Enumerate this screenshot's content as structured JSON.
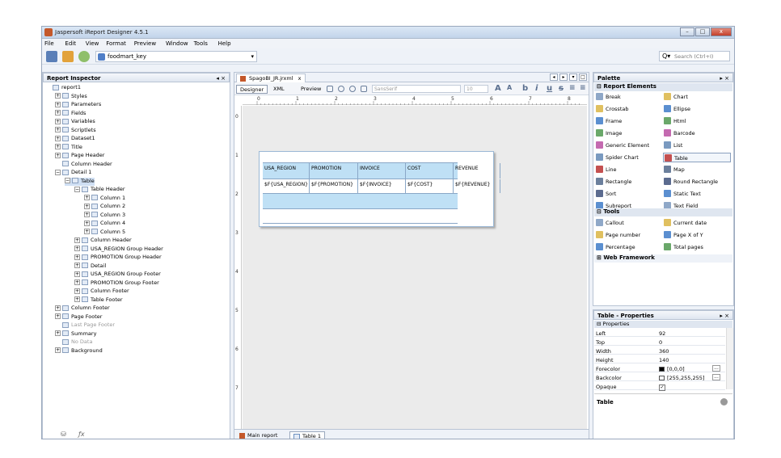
{
  "window": {
    "title": "Jaspersoft iReport Designer 4.5.1",
    "minimize": "–",
    "maximize": "□",
    "close": "x"
  },
  "menu": [
    "File",
    "Edit",
    "View",
    "Format",
    "Preview",
    "Window",
    "Tools",
    "Help"
  ],
  "toolbar": {
    "datasource": "foodmart_key",
    "search_placeholder": "Search (Ctrl+I)"
  },
  "inspector": {
    "title": "Report Inspector",
    "tree": [
      {
        "label": "report1",
        "indent": 0,
        "exp": ""
      },
      {
        "label": "Styles",
        "indent": 1,
        "exp": "+"
      },
      {
        "label": "Parameters",
        "indent": 1,
        "exp": "+"
      },
      {
        "label": "Fields",
        "indent": 1,
        "exp": "+"
      },
      {
        "label": "Variables",
        "indent": 1,
        "exp": "+"
      },
      {
        "label": "Scriptlets",
        "indent": 1,
        "exp": "+"
      },
      {
        "label": "Dataset1",
        "indent": 1,
        "exp": "+"
      },
      {
        "label": "Title",
        "indent": 1,
        "exp": "+"
      },
      {
        "label": "Page Header",
        "indent": 1,
        "exp": "+"
      },
      {
        "label": "Column Header",
        "indent": 1,
        "exp": ""
      },
      {
        "label": "Detail 1",
        "indent": 1,
        "exp": "−"
      },
      {
        "label": "Table",
        "indent": 2,
        "exp": "−",
        "selected": true
      },
      {
        "label": "Table Header",
        "indent": 3,
        "exp": "−"
      },
      {
        "label": "Column 1",
        "indent": 4,
        "exp": "+"
      },
      {
        "label": "Column 2",
        "indent": 4,
        "exp": "+"
      },
      {
        "label": "Column 3",
        "indent": 4,
        "exp": "+"
      },
      {
        "label": "Column 4",
        "indent": 4,
        "exp": "+"
      },
      {
        "label": "Column 5",
        "indent": 4,
        "exp": "+"
      },
      {
        "label": "Column Header",
        "indent": 3,
        "exp": "+"
      },
      {
        "label": "USA_REGION Group Header",
        "indent": 3,
        "exp": "+"
      },
      {
        "label": "PROMOTION Group Header",
        "indent": 3,
        "exp": "+"
      },
      {
        "label": "Detail",
        "indent": 3,
        "exp": "+"
      },
      {
        "label": "USA_REGION Group Footer",
        "indent": 3,
        "exp": "+"
      },
      {
        "label": "PROMOTION Group Footer",
        "indent": 3,
        "exp": "+"
      },
      {
        "label": "Column Footer",
        "indent": 3,
        "exp": "+"
      },
      {
        "label": "Table Footer",
        "indent": 3,
        "exp": "+"
      },
      {
        "label": "Column Footer",
        "indent": 1,
        "exp": "+"
      },
      {
        "label": "Page Footer",
        "indent": 1,
        "exp": "+"
      },
      {
        "label": "Last Page Footer",
        "indent": 1,
        "exp": "",
        "dim": true
      },
      {
        "label": "Summary",
        "indent": 1,
        "exp": "+"
      },
      {
        "label": "No Data",
        "indent": 1,
        "exp": "",
        "dim": true
      },
      {
        "label": "Background",
        "indent": 1,
        "exp": "+"
      }
    ]
  },
  "editor": {
    "tab": "SpagoBI_JR.jrxml",
    "tab_close": "x",
    "views": {
      "designer": "Designer",
      "xml": "XML",
      "preview": "Preview"
    },
    "font_name": "SansSerif",
    "font_size": "10",
    "ruler": [
      "0",
      "1",
      "2",
      "3",
      "4",
      "5",
      "6",
      "7",
      "8"
    ],
    "ruler_left": [
      "0",
      "1",
      "2",
      "3",
      "4",
      "5",
      "6",
      "7"
    ],
    "table": {
      "headers": [
        "USA_REGION",
        "PROMOTION",
        "INVOICE",
        "COST",
        "REVENUE"
      ],
      "fields": [
        "$F{USA_REGION}",
        "$F{PROMOTION}",
        "$F{INVOICE}",
        "$F{COST}",
        "$F{REVENUE}"
      ]
    },
    "bottom_tabs": [
      "Main report",
      "Table 1"
    ]
  },
  "palette": {
    "title": "Palette",
    "sections": {
      "report_elements": "Report Elements",
      "tools": "Tools",
      "web_framework": "Web Framework"
    },
    "report_items": [
      [
        "Break",
        "Chart"
      ],
      [
        "Crosstab",
        "Ellipse"
      ],
      [
        "Frame",
        "Html"
      ],
      [
        "Image",
        "Barcode"
      ],
      [
        "Generic Element",
        "List"
      ],
      [
        "Spider Chart",
        "Table"
      ],
      [
        "Line",
        "Map"
      ],
      [
        "Rectangle",
        "Round Rectangle"
      ],
      [
        "Sort",
        "Static Text"
      ],
      [
        "Subreport",
        "Text Field"
      ]
    ],
    "tool_items": [
      [
        "Callout",
        "Current date"
      ],
      [
        "Page number",
        "Page X of Y"
      ],
      [
        "Percentage",
        "Total pages"
      ]
    ]
  },
  "properties": {
    "title": "Table - Properties",
    "group": "Properties",
    "rows": [
      {
        "k": "Left",
        "v": "92"
      },
      {
        "k": "Top",
        "v": "0"
      },
      {
        "k": "Width",
        "v": "360"
      },
      {
        "k": "Height",
        "v": "140"
      },
      {
        "k": "Forecolor",
        "v": "[0,0,0]"
      },
      {
        "k": "Backcolor",
        "v": "[255,255,255]"
      },
      {
        "k": "Opaque",
        "v": "✓"
      }
    ],
    "desc_title": "Table"
  },
  "colors": {
    "accent": "#4f7ec7",
    "band": "#bfe0f5",
    "selection": "#cfdff3"
  }
}
